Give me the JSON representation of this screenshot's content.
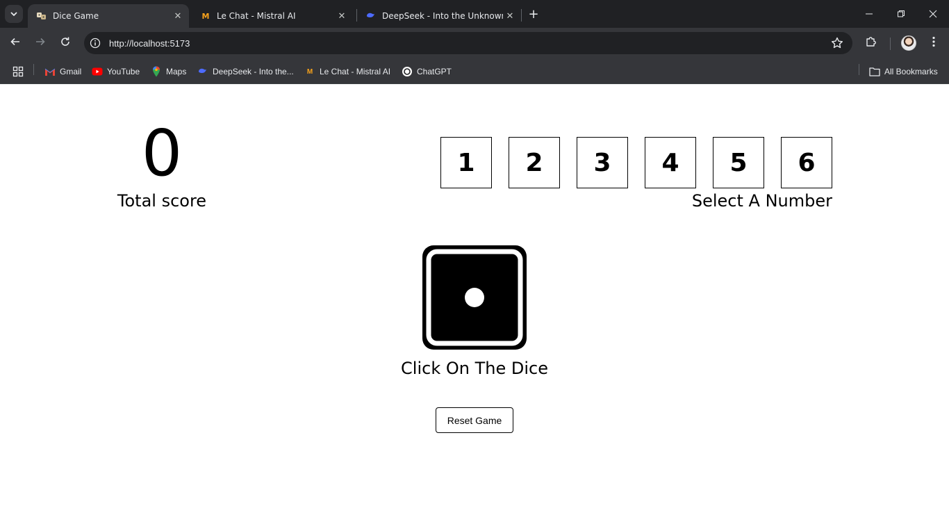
{
  "browser": {
    "tabs": [
      {
        "title": "Dice Game",
        "favicon": "dice-favicon",
        "active": true
      },
      {
        "title": "Le Chat - Mistral AI",
        "favicon": "mistral-favicon",
        "active": false
      },
      {
        "title": "DeepSeek - Into the Unknown",
        "favicon": "deepseek-favicon",
        "active": false
      }
    ],
    "url": "http://localhost:5173",
    "bookmarks": [
      {
        "label": "Gmail",
        "icon": "gmail-icon"
      },
      {
        "label": "YouTube",
        "icon": "youtube-icon"
      },
      {
        "label": "Maps",
        "icon": "maps-icon"
      },
      {
        "label": "DeepSeek - Into the...",
        "icon": "deepseek-icon"
      },
      {
        "label": "Le Chat - Mistral AI",
        "icon": "mistral-icon"
      },
      {
        "label": "ChatGPT",
        "icon": "chatgpt-icon"
      }
    ],
    "all_bookmarks_label": "All Bookmarks"
  },
  "game": {
    "total_score": "0",
    "total_score_label": "Total score",
    "numbers": [
      "1",
      "2",
      "3",
      "4",
      "5",
      "6"
    ],
    "select_label": "Select A Number",
    "dice_face": 1,
    "dice_label": "Click On The Dice",
    "reset_label": "Reset Game"
  },
  "colors": {
    "chrome_dark": "#202124",
    "chrome_mid": "#35363a",
    "page_bg": "#ffffff",
    "ink": "#000000"
  }
}
